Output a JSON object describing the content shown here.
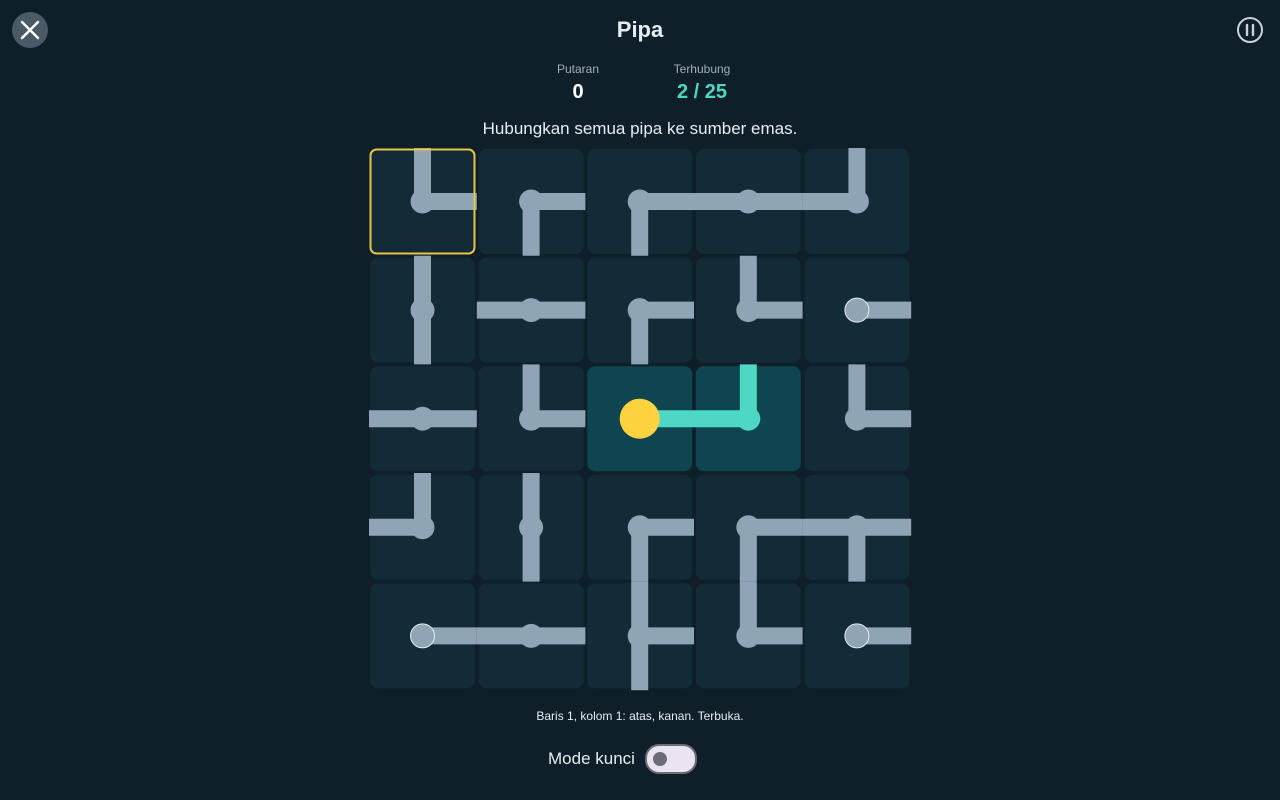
{
  "header": {
    "title": "Pipa",
    "close_icon": "close-icon",
    "pause_icon": "pause-icon"
  },
  "stats": {
    "turns_label": "Putaran",
    "turns_value": "0",
    "connected_label": "Terhubung",
    "connected_value": "2 / 25"
  },
  "instruction": "Hubungkan semua pipa ke sumber emas.",
  "board": {
    "rows": 5,
    "cols": 5,
    "selected": [
      0,
      0
    ],
    "source": [
      2,
      2
    ],
    "cells": [
      [
        {
          "openings": [
            "N",
            "E"
          ]
        },
        {
          "openings": [
            "E",
            "S"
          ]
        },
        {
          "openings": [
            "E",
            "S"
          ]
        },
        {
          "openings": [
            "W",
            "E"
          ]
        },
        {
          "openings": [
            "N",
            "W"
          ]
        }
      ],
      [
        {
          "openings": [
            "N",
            "S"
          ]
        },
        {
          "openings": [
            "W",
            "E"
          ]
        },
        {
          "openings": [
            "E",
            "S"
          ]
        },
        {
          "openings": [
            "N",
            "E"
          ]
        },
        {
          "openings": [
            "E"
          ]
        }
      ],
      [
        {
          "openings": [
            "W",
            "E"
          ]
        },
        {
          "openings": [
            "N",
            "E"
          ]
        },
        {
          "openings": [
            "E"
          ],
          "connected": true,
          "source": true
        },
        {
          "openings": [
            "N",
            "W"
          ],
          "connected": true
        },
        {
          "openings": [
            "N",
            "E"
          ]
        }
      ],
      [
        {
          "openings": [
            "N",
            "W"
          ]
        },
        {
          "openings": [
            "N",
            "S"
          ]
        },
        {
          "openings": [
            "E",
            "S"
          ]
        },
        {
          "openings": [
            "E",
            "S"
          ]
        },
        {
          "openings": [
            "W",
            "E",
            "S"
          ]
        }
      ],
      [
        {
          "openings": [
            "E"
          ]
        },
        {
          "openings": [
            "W",
            "E"
          ]
        },
        {
          "openings": [
            "N",
            "E",
            "S"
          ]
        },
        {
          "openings": [
            "N",
            "E"
          ]
        },
        {
          "openings": [
            "E"
          ]
        }
      ]
    ]
  },
  "cell_status": "Baris 1, kolom 1: atas, kanan. Terbuka.",
  "lock_mode": {
    "label": "Mode kunci",
    "on": false
  },
  "colors": {
    "background": "#0e1f2a",
    "tile": "#132a37",
    "tile_connected": "#0f4550",
    "pipe": "#8fa4b4",
    "pipe_connected": "#4dd8c4",
    "source": "#ffd23f",
    "selection": "#e8c547",
    "accent": "#4dd8c4"
  }
}
